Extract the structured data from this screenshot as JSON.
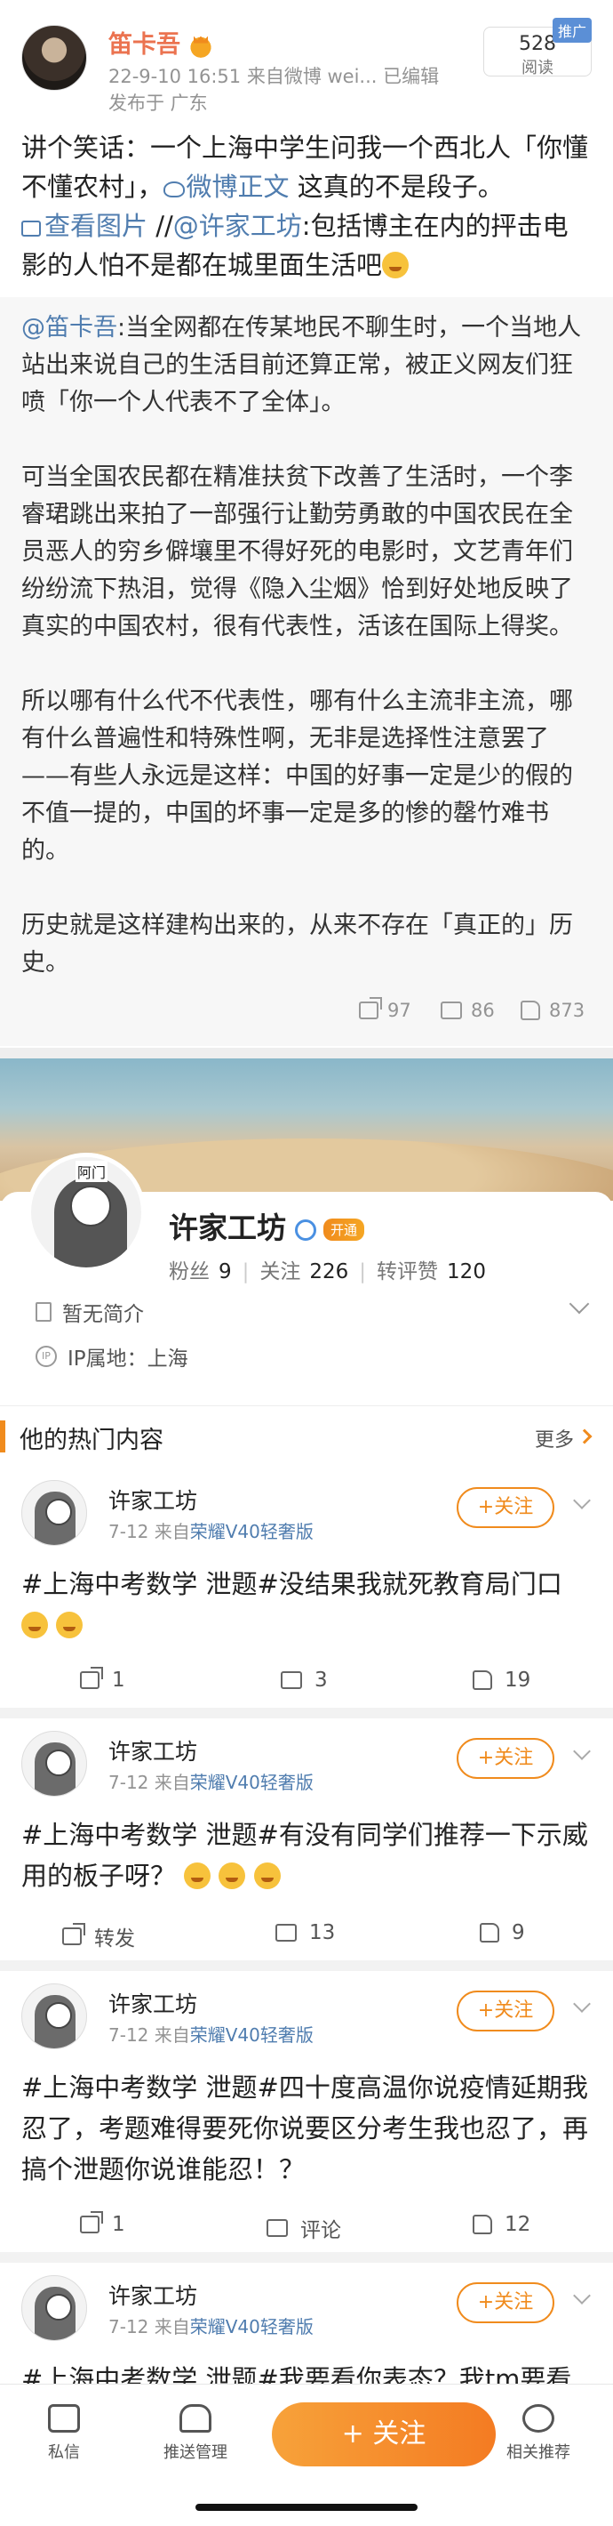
{
  "post": {
    "author": "笛卡吾",
    "meta_line1": "22-9-10 16:51  来自微博 wei...  已编辑",
    "meta_line2": "发布于 广东",
    "read_count": "528",
    "read_label": "阅读",
    "promo_badge": "推广",
    "text_part1": "讲个笑话：一个上海中学生问我一个西北人「你懂不懂农村」，",
    "weibo_link": "微博正文",
    "text_part2": " 这真的不是段子。",
    "view_image": "查看图片",
    "text_part3": " //",
    "mention": "@许家工坊",
    "text_part4": ":包括博主在内的抨击电影的人怕不是都在城里面生活吧",
    "emoji": "smile-emoji"
  },
  "repost": {
    "mention": "@笛卡吾",
    "body": ":当全网都在传某地民不聊生时，一个当地人站出来说自己的生活目前还算正常，被正义网友们狂喷「你一个人代表不了全体」。\n\n可当全国农民都在精准扶贫下改善了生活时，一个李睿珺跳出来拍了一部强行让勤劳勇敢的中国农民在全员恶人的穷乡僻壤里不得好死的电影时，文艺青年们纷纷流下热泪，觉得《隐入尘烟》恰到好处地反映了真实的中国农村，很有代表性，活该在国际上得奖。\n\n所以哪有什么代不代表性，哪有什么主流非主流，哪有什么普遍性和特殊性啊，无非是选择性注意罢了——有些人永远是这样：中国的好事一定是少的假的不值一提的，中国的坏事一定是多的惨的罄竹难书的。\n\n历史就是这样建构出来的，从来不存在「真正的」历史。",
    "shares": "97",
    "comments": "86",
    "likes": "873"
  },
  "profile": {
    "avatar_tag": "阿门",
    "name": "许家工坊",
    "open_badge": "开通",
    "fans_label": "粉丝",
    "fans": "9",
    "follow_label": "关注",
    "follow": "226",
    "repost_like_label": "转评赞",
    "repost_like": "120",
    "intro": "暂无简介",
    "ip": "IP属地：上海"
  },
  "section": {
    "title": "他的热门内容",
    "more": "更多"
  },
  "feed": [
    {
      "name": "许家工坊",
      "date": "7-12",
      "from": "来自",
      "device": "荣耀V40轻奢版",
      "follow": "+关注",
      "text": "#上海中考数学 泄题#没结果我就死教育局门口",
      "share": "1",
      "comment": "3",
      "like": "19"
    },
    {
      "name": "许家工坊",
      "date": "7-12",
      "from": "来自",
      "device": "荣耀V40轻奢版",
      "follow": "+关注",
      "text": "#上海中考数学 泄题#有没有同学们推荐一下示威用的板子呀？",
      "share": "转发",
      "comment": "13",
      "like": "9"
    },
    {
      "name": "许家工坊",
      "date": "7-12",
      "from": "来自",
      "device": "荣耀V40轻奢版",
      "follow": "+关注",
      "text": "#上海中考数学 泄题#四十度高温你说疫情延期我忍了，考题难得要死你说要区分考生我也忍了，再搞个泄题你说谁能忍！？",
      "share": "1",
      "comment": "评论",
      "like": "12"
    },
    {
      "name": "许家工坊",
      "date": "7-12",
      "from": "来自",
      "device": "荣耀V40轻奢版",
      "follow": "+关注",
      "text": "#上海中考数学 泄题#我要看你表态？我tm要看"
    }
  ],
  "bottombar": {
    "messages": "私信",
    "push": "推送管理",
    "follow": "+ 关注",
    "recommend": "相关推荐"
  },
  "colors": {
    "accent": "#f08b1d",
    "link": "#507daf",
    "author": "#eb7350"
  }
}
